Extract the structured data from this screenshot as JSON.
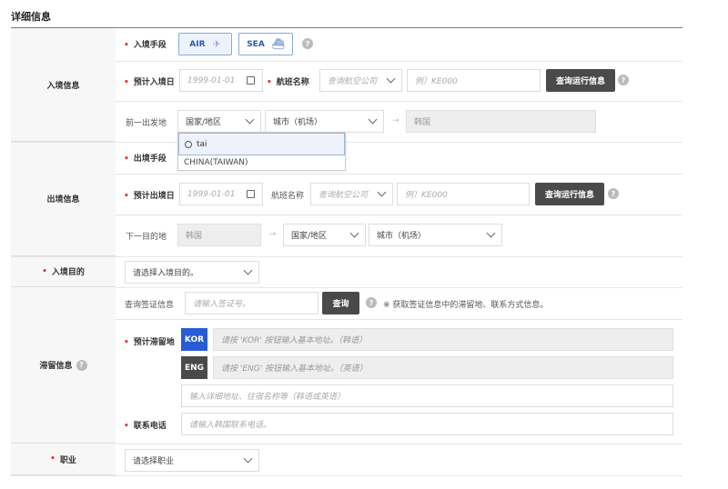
{
  "section_title": "详细信息",
  "entry": {
    "group_label": "入境信息",
    "means_label": "入境手段",
    "air_label": "AIR",
    "sea_label": "SEA",
    "date_label": "预计入境日",
    "date_placeholder": "1999-01-01",
    "flight_label": "航班名称",
    "airline_placeholder": "查询航空公司",
    "flight_placeholder": "例）KE000",
    "query_button": "查询运行信息",
    "origin_label": "前一出发地",
    "country_placeholder": "国家/地区",
    "city_placeholder": "城市（机场）",
    "destination_value": "韩国",
    "dropdown": {
      "search_value": "tai",
      "options": [
        "CHINA(TAIWAN)"
      ]
    }
  },
  "exit": {
    "group_label": "出境信息",
    "means_label": "出境手段",
    "date_label": "预计出境日",
    "date_placeholder": "1999-01-01",
    "flight_label": "航班名称",
    "airline_placeholder": "查询航空公司",
    "flight_placeholder": "例）KE000",
    "query_button": "查询运行信息",
    "next_label": "下一目的地",
    "origin_value": "韩国",
    "country_placeholder": "国家/地区",
    "city_placeholder": "城市（机场）"
  },
  "purpose": {
    "label": "入境目的",
    "placeholder": "请选择入境目的。"
  },
  "stay": {
    "group_label": "滞留信息",
    "visa_label": "查询签证信息",
    "visa_placeholder": "请输入签证号。",
    "visa_button": "查询",
    "visa_note": "※ 获取签证信息中的滞留地、联系方式信息。",
    "address_label": "预计滞留地",
    "kor_button": "KOR",
    "kor_placeholder": "请按 'KOR' 按钮输入基本地址。（韩语）",
    "eng_button": "ENG",
    "eng_placeholder": "请按 'ENG' 按钮输入基本地址。（英语）",
    "detail_placeholder": "输入详细地址、住宿名称等（韩语或英语）",
    "phone_label": "联系电话",
    "phone_placeholder": "请输入韩国联系电话。"
  },
  "job": {
    "label": "职业",
    "placeholder": "请选择职业"
  },
  "colors": {
    "accent": "#2a5bd7",
    "dark_button": "#4a4a4a",
    "required": "#dd3333"
  }
}
